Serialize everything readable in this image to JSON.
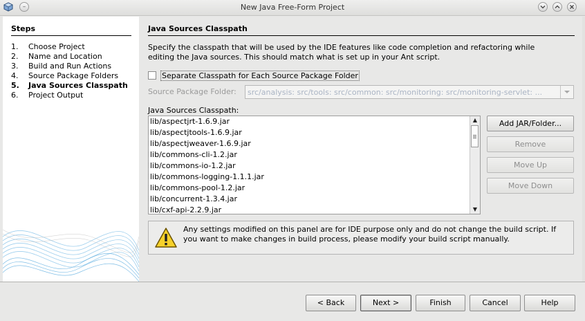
{
  "window": {
    "title": "New Java Free-Form Project",
    "controls": [
      "chevron-down-icon",
      "chevron-up-icon",
      "close-icon"
    ]
  },
  "steps": {
    "heading": "Steps",
    "items": [
      {
        "num": "1.",
        "label": "Choose Project"
      },
      {
        "num": "2.",
        "label": "Name and Location"
      },
      {
        "num": "3.",
        "label": "Build and Run Actions"
      },
      {
        "num": "4.",
        "label": "Source Package Folders"
      },
      {
        "num": "5.",
        "label": "Java Sources Classpath"
      },
      {
        "num": "6.",
        "label": "Project Output"
      }
    ],
    "current_index": 4
  },
  "panel": {
    "title": "Java Sources Classpath",
    "description": "Specify the classpath that will be used by the IDE features like code completion and refactoring while editing the Java sources. This should match what is set up in your Ant script.",
    "separate_checkbox": {
      "label": "Separate Classpath for Each Source Package Folder",
      "checked": false
    },
    "source_package_folder": {
      "label": "Source Package Folder:",
      "value": "src/analysis: src/tools: src/common: src/monitoring: src/monitoring-servlet: ...",
      "enabled": false
    },
    "classpath_label": "Java Sources Classpath:",
    "classpath_items": [
      "lib/aspectjrt-1.6.9.jar",
      "lib/aspectjtools-1.6.9.jar",
      "lib/aspectjweaver-1.6.9.jar",
      "lib/commons-cli-1.2.jar",
      "lib/commons-io-1.2.jar",
      "lib/commons-logging-1.1.1.jar",
      "lib/commons-pool-1.2.jar",
      "lib/concurrent-1.3.4.jar",
      "lib/cxf-api-2.2.9.jar"
    ],
    "side_buttons": {
      "add": "Add JAR/Folder...",
      "remove": "Remove",
      "move_up": "Move Up",
      "move_down": "Move Down"
    },
    "notice": "Any settings modified on this panel are for IDE purpose only and do not change the build script. If you want to make changes in build process, please modify your build script manually."
  },
  "footer": {
    "back": "< Back",
    "next": "Next >",
    "finish": "Finish",
    "cancel": "Cancel",
    "help": "Help"
  }
}
